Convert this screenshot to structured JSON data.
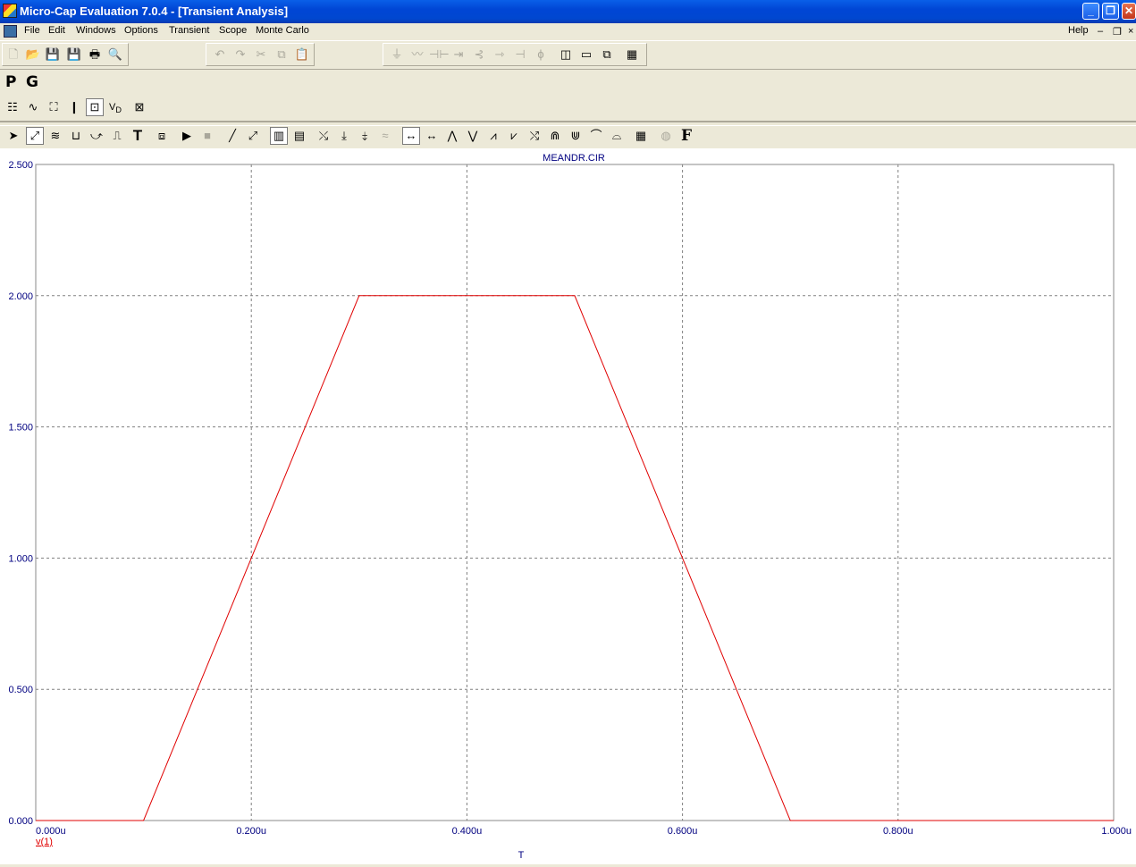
{
  "window": {
    "title": "Micro-Cap Evaluation 7.0.4 - [Transient Analysis]"
  },
  "menu": {
    "items": [
      "File",
      "Edit",
      "Windows",
      "Options",
      "Transient",
      "Scope",
      "Monte Carlo"
    ],
    "help": "Help"
  },
  "toolbar": {
    "p_label": "P",
    "g_label": "G"
  },
  "chart_data": {
    "type": "line",
    "title": "MEANDR.CIR",
    "xlabel": "T",
    "ylabel": "",
    "xlim": [
      0,
      1.0
    ],
    "ylim": [
      0,
      2.5
    ],
    "x_unit": "u",
    "grid": true,
    "xticks": [
      "0.000u",
      "0.200u",
      "0.400u",
      "0.600u",
      "0.800u",
      "1.000u"
    ],
    "yticks": [
      "0.000",
      "0.500",
      "1.000",
      "1.500",
      "2.000",
      "2.500"
    ],
    "series": [
      {
        "name": "v(1)",
        "color": "#e00000",
        "x": [
          0,
          0.1,
          0.3,
          0.5,
          0.7,
          1.0
        ],
        "y": [
          0,
          0,
          2.0,
          2.0,
          0,
          0
        ]
      }
    ]
  },
  "colors": {
    "axis_text": "#000080",
    "trace": "#e00000",
    "titlebar": "#0a5fe8"
  }
}
